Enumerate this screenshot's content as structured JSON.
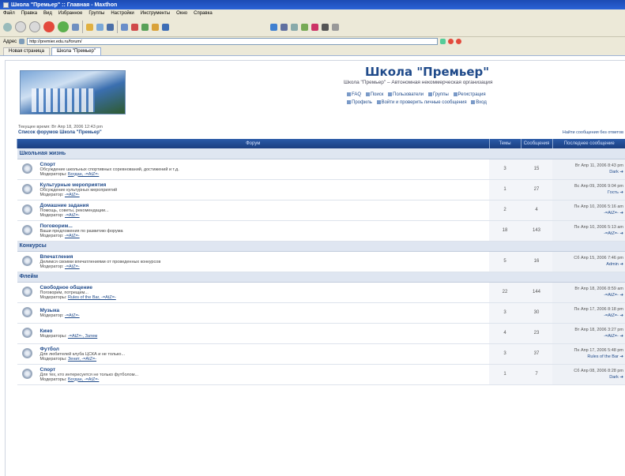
{
  "window": {
    "title": "Школа \"Премьер\" :: Главная - Maxthon"
  },
  "menu": [
    "Файл",
    "Правка",
    "Вид",
    "Избранное",
    "Группы",
    "Настройки",
    "Инструменты",
    "Окно",
    "Справка"
  ],
  "addressbar": {
    "label": "Адрес",
    "url": "http://premier.edu.ru/forum/"
  },
  "tabs": [
    {
      "label": "Новая страница",
      "active": false
    },
    {
      "label": "Школа \"Премьер\"",
      "active": true
    }
  ],
  "site": {
    "title": "Школа \"Премьер\"",
    "description": "Школа \"Премьер\" – Автономная некоммерческая организация",
    "nav": [
      "FAQ",
      "Поиск",
      "Пользователи",
      "Группы",
      "Регистрация",
      "Профиль",
      "Войти и проверить личные сообщения",
      "Вход"
    ]
  },
  "current_time": "Текущее время: Вт Апр 18, 2006 12:43 pm",
  "breadcrumb": "Список форумов Школа \"Премьер\"",
  "unanswered_link": "Найти сообщения без ответов",
  "table_headers": {
    "forum": "Форум",
    "topics": "Темы",
    "posts": "Сообщения",
    "last_post": "Последнее сообщение"
  },
  "categories": [
    {
      "name": "Школьная жизнь",
      "forums": [
        {
          "name": "Спорт",
          "desc": "Обсуждение школьных спортивных соревнований, достижений и т.д.",
          "mods_label": "Модераторы:",
          "mods": "Богдан, -=AtZ=-",
          "topics": "3",
          "posts": "15",
          "last_date": "Вт Апр 11, 2006 8:43 pm",
          "last_user": "Dark"
        },
        {
          "name": "Культурные мероприятия",
          "desc": "Обсуждение культурных мероприятий",
          "mods_label": "Модератор:",
          "mods": "-=AtZ=-",
          "topics": "1",
          "posts": "27",
          "last_date": "Вс Апр 09, 2006 9:04 pm",
          "last_user": "Гость"
        },
        {
          "name": "Домашние задания",
          "desc": "Помощь, советы, рекомендации...",
          "mods_label": "Модератор:",
          "mods": "-=AtZ=-",
          "topics": "2",
          "posts": "4",
          "last_date": "Пн Апр 10, 2006 5:16 am",
          "last_user": "-=AtZ=-"
        },
        {
          "name": "Поговорим...",
          "desc": "Ваши предложения по развитию форума",
          "mods_label": "Модератор:",
          "mods": "-=AtZ=-",
          "topics": "18",
          "posts": "143",
          "last_date": "Пн Апр 10, 2006 5:13 am",
          "last_user": "-=AtZ=-"
        }
      ]
    },
    {
      "name": "Конкурсы",
      "forums": [
        {
          "name": "Впечатления",
          "desc": "Делимся своими впечатлениями от проведенных конкурсов",
          "mods_label": "Модератор:",
          "mods": "-=AtZ=-",
          "topics": "5",
          "posts": "16",
          "last_date": "Сб Апр 15, 2006 7:46 pm",
          "last_user": "Admin"
        }
      ]
    },
    {
      "name": "Флейм",
      "forums": [
        {
          "name": "Свободное общение",
          "desc": "Поговорим, потрещим...",
          "mods_label": "Модераторы:",
          "mods": "Rules of the Bar, -=AtZ=-",
          "topics": "22",
          "posts": "144",
          "last_date": "Вт Апр 18, 2006 8:59 am",
          "last_user": "-=AtZ=-"
        },
        {
          "name": "Музыка",
          "desc": "",
          "mods_label": "Модератор:",
          "mods": "-=AtZ=-",
          "topics": "3",
          "posts": "30",
          "last_date": "Пн Апр 17, 2006 8:18 pm",
          "last_user": "-=AtZ=-"
        },
        {
          "name": "Кино",
          "desc": "",
          "mods_label": "Модераторы:",
          "mods": "-=AtZ=-, Затем",
          "topics": "4",
          "posts": "23",
          "last_date": "Вт Апр 18, 2006 3:27 pm",
          "last_user": "-=AtZ=-"
        },
        {
          "name": "Футбол",
          "desc": "Для любителей клуба ЦСКА и не только...",
          "mods_label": "Модераторы:",
          "mods": "Зенит, -=AtZ=-",
          "topics": "3",
          "posts": "37",
          "last_date": "Пн Апр 17, 2006 5:48 pm",
          "last_user": "Rules of the Bar"
        },
        {
          "name": "Спорт",
          "desc": "Для тех, кто интересуется не только футболом...",
          "mods_label": "Модераторы:",
          "mods": "Богдан, -=AtZ=-",
          "topics": "1",
          "posts": "7",
          "last_date": "Сб Апр 08, 2006 8:28 pm",
          "last_user": "Dark"
        }
      ]
    }
  ]
}
